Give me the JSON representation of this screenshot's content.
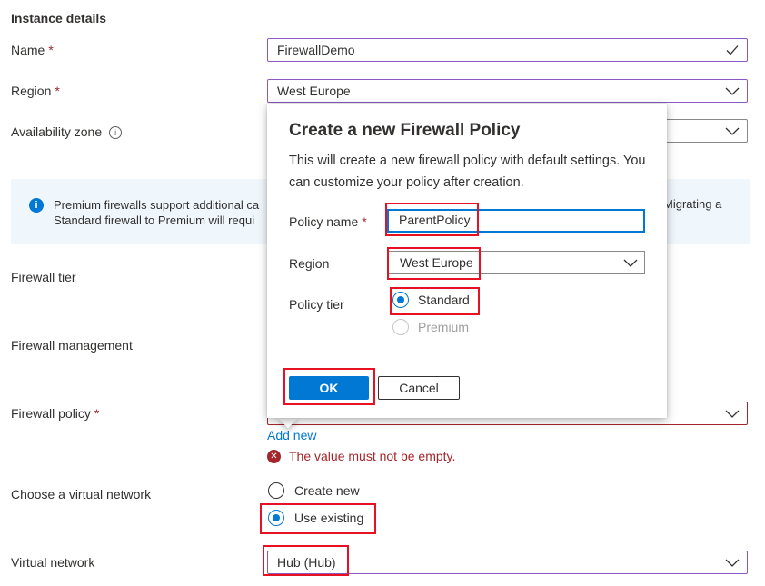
{
  "section": {
    "title": "Instance details"
  },
  "form": {
    "name": {
      "label": "Name",
      "required": "*",
      "value": "FirewallDemo"
    },
    "region": {
      "label": "Region",
      "required": "*",
      "value": "West Europe"
    },
    "availability_zone": {
      "label": "Availability zone",
      "info": "i",
      "value": ""
    },
    "banner": {
      "icon": "i",
      "line1": "Premium firewalls support additional ca",
      "line2": "Standard firewall to Premium will requi",
      "line1_tail": "Migrating a"
    },
    "firewall_tier": {
      "label": "Firewall tier"
    },
    "firewall_management": {
      "label": "Firewall management"
    },
    "firewall_policy": {
      "label": "Firewall policy",
      "required": "*",
      "add_new": "Add new",
      "error": "The value must not be empty.",
      "error_icon": "✕"
    },
    "virtual_network": {
      "choose_label": "Choose a virtual network",
      "options": [
        "Create new",
        "Use existing"
      ],
      "selected": "Use existing",
      "label": "Virtual network",
      "value": "Hub (Hub)"
    }
  },
  "dialog": {
    "title": "Create a new Firewall Policy",
    "description": "This will create a new firewall policy with default settings. You can customize your policy after creation.",
    "policy_name": {
      "label": "Policy name",
      "required": "*",
      "value": "ParentPolicy"
    },
    "region": {
      "label": "Region",
      "value": "West Europe"
    },
    "policy_tier": {
      "label": "Policy tier",
      "options": [
        "Standard",
        "Premium"
      ],
      "selected": "Standard"
    },
    "ok_label": "OK",
    "cancel_label": "Cancel"
  },
  "colors": {
    "accent": "#0078d4",
    "focus_border": "#8a59c4",
    "error": "#a4262c",
    "highlight": "#e81123"
  },
  "icons": {
    "checkmark": "check-icon",
    "dropdown": "chevron-down-icon",
    "info": "info-icon",
    "error": "error-circle-icon"
  }
}
